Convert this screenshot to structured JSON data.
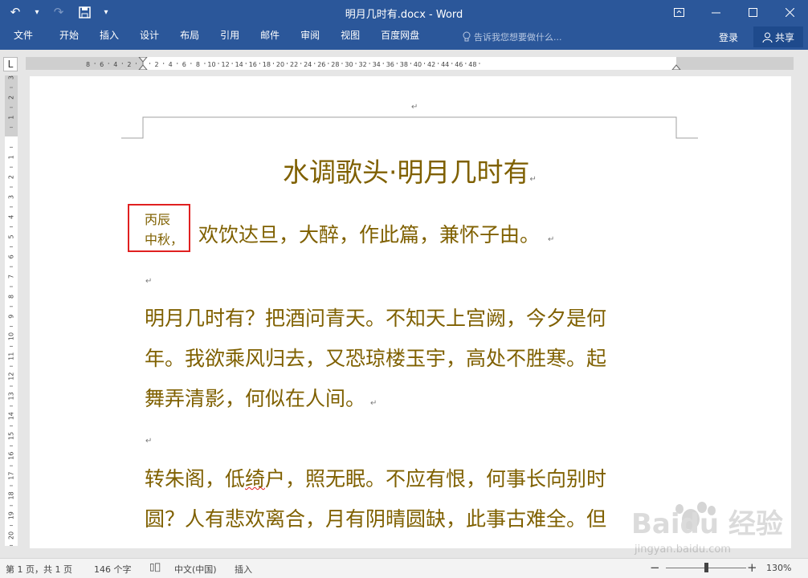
{
  "title_bar": {
    "title": "明月几时有.docx - Word",
    "qat": {
      "undo_icon": "undo-icon",
      "redo_icon": "redo-icon",
      "save_icon": "save-icon",
      "customize_icon": "chevron-down-icon"
    }
  },
  "ribbon": {
    "tabs": [
      "文件",
      "开始",
      "插入",
      "设计",
      "布局",
      "引用",
      "邮件",
      "审阅",
      "视图",
      "百度网盘"
    ],
    "tell_me": "告诉我您想要做什么...",
    "login": "登录",
    "share": "共享"
  },
  "ruler": {
    "tab_selector": "L",
    "h_labels": [
      "8",
      "6",
      "4",
      "2",
      "2",
      "4",
      "6",
      "8",
      "10",
      "12",
      "14",
      "16",
      "18",
      "20",
      "22",
      "24",
      "26",
      "28",
      "30",
      "32",
      "34",
      "36",
      "38",
      "40",
      "42",
      "44",
      "46",
      "48"
    ],
    "v_labels": [
      "3",
      "2",
      "1",
      "1",
      "2",
      "3",
      "4",
      "5",
      "6",
      "7",
      "8",
      "9",
      "10",
      "11",
      "12",
      "13",
      "14",
      "15",
      "16",
      "17",
      "18",
      "19",
      "20"
    ]
  },
  "document": {
    "heading": "水调歌头·明月几时有",
    "preface_small_line1": "丙辰",
    "preface_small_line2": "中秋，",
    "preface_rest": "欢饮达旦，大醉，作此篇，兼怀子由。",
    "para1": [
      "明月几时有？把酒问青天。不知天上宫阙，今夕是何",
      "年。我欲乘风归去，又恐琼楼玉宇，高处不胜寒。起",
      "舞弄清影，何似在人间。"
    ],
    "para2_l1_a": "转朱阁，低",
    "para2_l1_b": "绮",
    "para2_l1_c": "户，照无眠。不应有恨，何事长向别时",
    "para2_l2": "圆？人有悲欢离合，月有阴晴圆缺，此事古难全。但",
    "paragraph_mark": "↵"
  },
  "status_bar": {
    "page": "第 1 页，共 1 页",
    "words": "146 个字",
    "language": "中文(中国)",
    "mode": "插入",
    "zoom": "130%"
  },
  "watermark": {
    "text": "Baidu 经验",
    "url": "jingyan.baidu.com"
  }
}
